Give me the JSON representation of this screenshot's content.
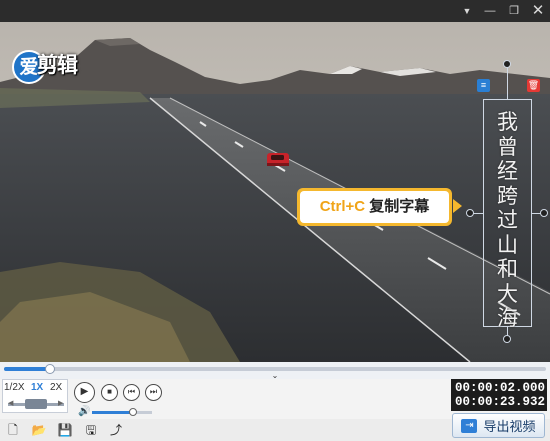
{
  "window": {
    "menu_icon": "dropdown-menu-icon",
    "min_label": "—",
    "max_label": "❐",
    "close_label": "✕"
  },
  "logo": {
    "circle_char": "爱",
    "text": "剪辑"
  },
  "subtitle": {
    "characters": [
      "我",
      "曾",
      "经",
      "跨",
      "过",
      "山",
      "和",
      "大",
      "海"
    ],
    "list_icon": "≡",
    "delete_icon": "🗑"
  },
  "tooltip": {
    "shortcut": "Ctrl+C",
    "label": " 复制字幕"
  },
  "timeline": {
    "progress": 0.085,
    "collapse_icon": "⌄"
  },
  "speed": {
    "options": [
      "1/2X",
      "1X",
      "2X"
    ],
    "selected": "1X",
    "prev_arrow": "◀",
    "next_arrow": "▶"
  },
  "playback": {
    "play": "▶",
    "stop": "■",
    "prev": "⏮",
    "next": "⏭"
  },
  "volume": {
    "icon": "🔊",
    "level": 0.68
  },
  "time": {
    "current": "00:00:02.000",
    "total": "00:00:23.932"
  },
  "toolbar": {
    "new_icon": "🗋",
    "open_icon": "📂",
    "save_icon": "💾",
    "save_as_icon": "🖫",
    "share_icon": "⤴",
    "export_icon": "⇥",
    "export_label": "导出视频"
  },
  "colors": {
    "accent": "#2f7fd6",
    "tooltip_border": "#f5b82e",
    "shortcut_text": "#f0a418",
    "delete_red": "#e53935",
    "car_red": "#c8232a"
  }
}
